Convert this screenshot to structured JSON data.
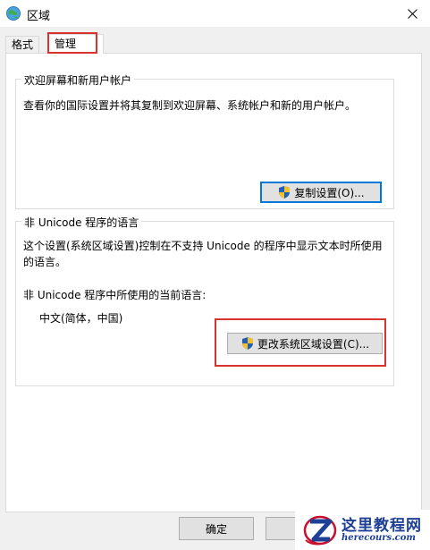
{
  "window": {
    "title": "区域",
    "app_icon": "globe-icon",
    "close_icon": "close-icon"
  },
  "tabs": [
    {
      "label": "格式",
      "active": false
    },
    {
      "label": "管理",
      "active": true
    }
  ],
  "welcome_group": {
    "title": "欢迎屏幕和新用户帐户",
    "description": "查看你的国际设置并将其复制到欢迎屏幕、系统帐户和新的用户帐户。",
    "copy_button": "复制设置(O)..."
  },
  "nonunicode_group": {
    "title": "非 Unicode 程序的语言",
    "description": "这个设置(系统区域设置)控制在不支持 Unicode 的程序中显示文本时所使用的语言。",
    "current_label": "非 Unicode 程序中所使用的当前语言:",
    "current_value": "中文(简体，中国)",
    "change_button": "更改系统区域设置(C)..."
  },
  "footer": {
    "ok_button": "确定",
    "cancel_button": "取"
  },
  "watermark": {
    "title": "这里教程网",
    "url": "herecours.com"
  },
  "colors": {
    "highlight": "#d9332e",
    "focus_border": "#0078d7",
    "watermark_text": "#1d3f95"
  }
}
